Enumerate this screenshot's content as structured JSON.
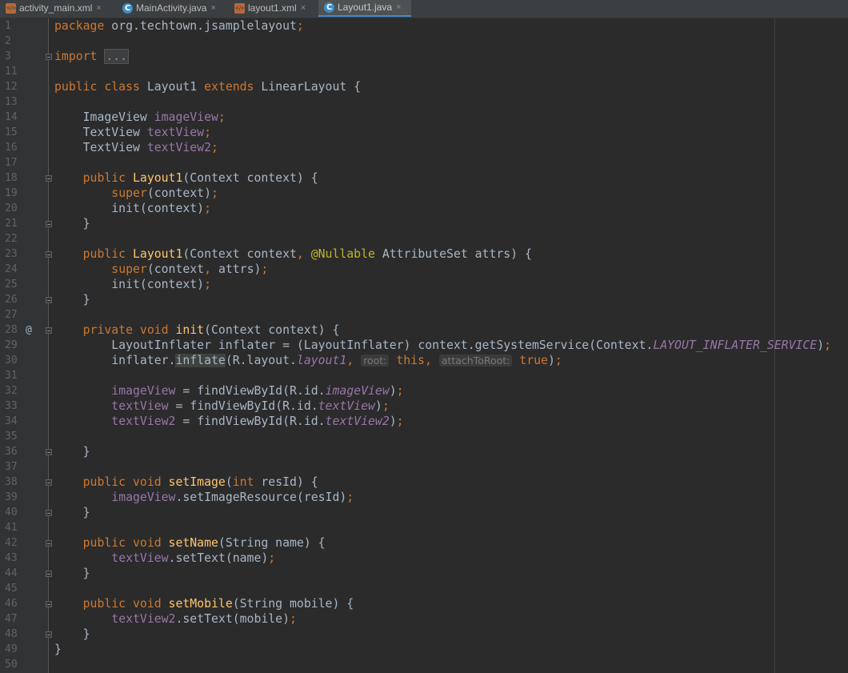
{
  "tabs": [
    {
      "label": "activity_main.xml",
      "kind": "xml",
      "active": false
    },
    {
      "label": "MainActivity.java",
      "kind": "java",
      "active": false
    },
    {
      "label": "layout1.xml",
      "kind": "xml",
      "active": false
    },
    {
      "label": "Layout1.java",
      "kind": "java",
      "active": true
    }
  ],
  "close_glyph": "×",
  "gutter_override_marker": "@",
  "line_numbers": [
    "1",
    "2",
    "3",
    "11",
    "12",
    "13",
    "14",
    "15",
    "16",
    "17",
    "18",
    "19",
    "20",
    "21",
    "22",
    "23",
    "24",
    "25",
    "26",
    "27",
    "28",
    "29",
    "30",
    "31",
    "32",
    "33",
    "34",
    "35",
    "36",
    "37",
    "38",
    "39",
    "40",
    "41",
    "42",
    "43",
    "44",
    "45",
    "46",
    "47",
    "48",
    "49",
    "50"
  ],
  "code_lines": [
    [
      {
        "t": "package ",
        "c": "kw"
      },
      {
        "t": "org.techtown.jsamplelayout"
      },
      {
        "t": ";",
        "c": "kw"
      }
    ],
    [],
    [
      {
        "t": "import ",
        "c": "kw"
      },
      {
        "t": "...",
        "c": "fold"
      }
    ],
    [],
    [
      {
        "t": "public class ",
        "c": "kw"
      },
      {
        "t": "Layout1 "
      },
      {
        "t": "extends ",
        "c": "kw"
      },
      {
        "t": "LinearLayout {"
      }
    ],
    [],
    [
      {
        "t": "    ImageView "
      },
      {
        "t": "imageView",
        "c": "fld"
      },
      {
        "t": ";",
        "c": "kw"
      }
    ],
    [
      {
        "t": "    TextView "
      },
      {
        "t": "textView",
        "c": "fld"
      },
      {
        "t": ";",
        "c": "kw"
      }
    ],
    [
      {
        "t": "    TextView "
      },
      {
        "t": "textView2",
        "c": "fld"
      },
      {
        "t": ";",
        "c": "kw"
      }
    ],
    [],
    [
      {
        "t": "    "
      },
      {
        "t": "public ",
        "c": "kw"
      },
      {
        "t": "Layout1",
        "c": "fn"
      },
      {
        "t": "(Context context) {"
      }
    ],
    [
      {
        "t": "        "
      },
      {
        "t": "super",
        "c": "kw"
      },
      {
        "t": "(context)"
      },
      {
        "t": ";",
        "c": "kw"
      }
    ],
    [
      {
        "t": "        init(context)"
      },
      {
        "t": ";",
        "c": "kw"
      }
    ],
    [
      {
        "t": "    }"
      }
    ],
    [],
    [
      {
        "t": "    "
      },
      {
        "t": "public ",
        "c": "kw"
      },
      {
        "t": "Layout1",
        "c": "fn"
      },
      {
        "t": "(Context context"
      },
      {
        "t": ", ",
        "c": "kw"
      },
      {
        "t": "@Nullable ",
        "c": "ann"
      },
      {
        "t": "AttributeSet attrs) {"
      }
    ],
    [
      {
        "t": "        "
      },
      {
        "t": "super",
        "c": "kw"
      },
      {
        "t": "(context"
      },
      {
        "t": ", ",
        "c": "kw"
      },
      {
        "t": "attrs)"
      },
      {
        "t": ";",
        "c": "kw"
      }
    ],
    [
      {
        "t": "        init(context)"
      },
      {
        "t": ";",
        "c": "kw"
      }
    ],
    [
      {
        "t": "    }"
      }
    ],
    [],
    [
      {
        "t": "    "
      },
      {
        "t": "private void ",
        "c": "kw"
      },
      {
        "t": "init",
        "c": "fn"
      },
      {
        "t": "(Context context) {"
      }
    ],
    [
      {
        "t": "        LayoutInflater inflater = (LayoutInflater) context.getSystemService(Context."
      },
      {
        "t": "LAYOUT_INFLATER_SERVICE",
        "c": "sfld"
      },
      {
        "t": ")"
      },
      {
        "t": ";",
        "c": "kw"
      }
    ],
    [
      {
        "t": "        inflater."
      },
      {
        "t": "inflate",
        "c": "hl"
      },
      {
        "t": "(R.layout."
      },
      {
        "t": "layout1",
        "c": "sfld"
      },
      {
        "t": ", ",
        "c": "kw"
      },
      {
        "t": "root:",
        "c": "hint"
      },
      {
        "t": " "
      },
      {
        "t": "this",
        "c": "kw"
      },
      {
        "t": ", ",
        "c": "kw"
      },
      {
        "t": "attachToRoot:",
        "c": "hint"
      },
      {
        "t": " "
      },
      {
        "t": "true",
        "c": "kw"
      },
      {
        "t": ")"
      },
      {
        "t": ";",
        "c": "kw"
      }
    ],
    [],
    [
      {
        "t": "        "
      },
      {
        "t": "imageView",
        "c": "fld"
      },
      {
        "t": " = findViewById(R.id."
      },
      {
        "t": "imageView",
        "c": "sfld"
      },
      {
        "t": ")"
      },
      {
        "t": ";",
        "c": "kw"
      }
    ],
    [
      {
        "t": "        "
      },
      {
        "t": "textView",
        "c": "fld"
      },
      {
        "t": " = findViewById(R.id."
      },
      {
        "t": "textView",
        "c": "sfld"
      },
      {
        "t": ")"
      },
      {
        "t": ";",
        "c": "kw"
      }
    ],
    [
      {
        "t": "        "
      },
      {
        "t": "textView2",
        "c": "fld"
      },
      {
        "t": " = findViewById(R.id."
      },
      {
        "t": "textView2",
        "c": "sfld"
      },
      {
        "t": ")"
      },
      {
        "t": ";",
        "c": "kw"
      }
    ],
    [],
    [
      {
        "t": "    }"
      }
    ],
    [],
    [
      {
        "t": "    "
      },
      {
        "t": "public void ",
        "c": "kw"
      },
      {
        "t": "setImage",
        "c": "fn"
      },
      {
        "t": "("
      },
      {
        "t": "int ",
        "c": "kw"
      },
      {
        "t": "resId) {"
      }
    ],
    [
      {
        "t": "        "
      },
      {
        "t": "imageView",
        "c": "fld"
      },
      {
        "t": ".setImageResource(resId)"
      },
      {
        "t": ";",
        "c": "kw"
      }
    ],
    [
      {
        "t": "    }"
      }
    ],
    [],
    [
      {
        "t": "    "
      },
      {
        "t": "public void ",
        "c": "kw"
      },
      {
        "t": "setName",
        "c": "fn"
      },
      {
        "t": "(String name) {"
      }
    ],
    [
      {
        "t": "        "
      },
      {
        "t": "textView",
        "c": "fld"
      },
      {
        "t": ".setText(name)"
      },
      {
        "t": ";",
        "c": "kw"
      }
    ],
    [
      {
        "t": "    }"
      }
    ],
    [],
    [
      {
        "t": "    "
      },
      {
        "t": "public void ",
        "c": "kw"
      },
      {
        "t": "setMobile",
        "c": "fn"
      },
      {
        "t": "(String mobile) {"
      }
    ],
    [
      {
        "t": "        "
      },
      {
        "t": "textView2",
        "c": "fld"
      },
      {
        "t": ".setText(mobile)"
      },
      {
        "t": ";",
        "c": "kw"
      }
    ],
    [
      {
        "t": "    }"
      }
    ],
    [
      {
        "t": "}"
      }
    ],
    []
  ],
  "colors": {
    "keyword": "#cc7832",
    "method": "#ffc66d",
    "field": "#9876aa",
    "annotation": "#bbb529",
    "text": "#a9b7c6",
    "background": "#2b2b2b"
  }
}
